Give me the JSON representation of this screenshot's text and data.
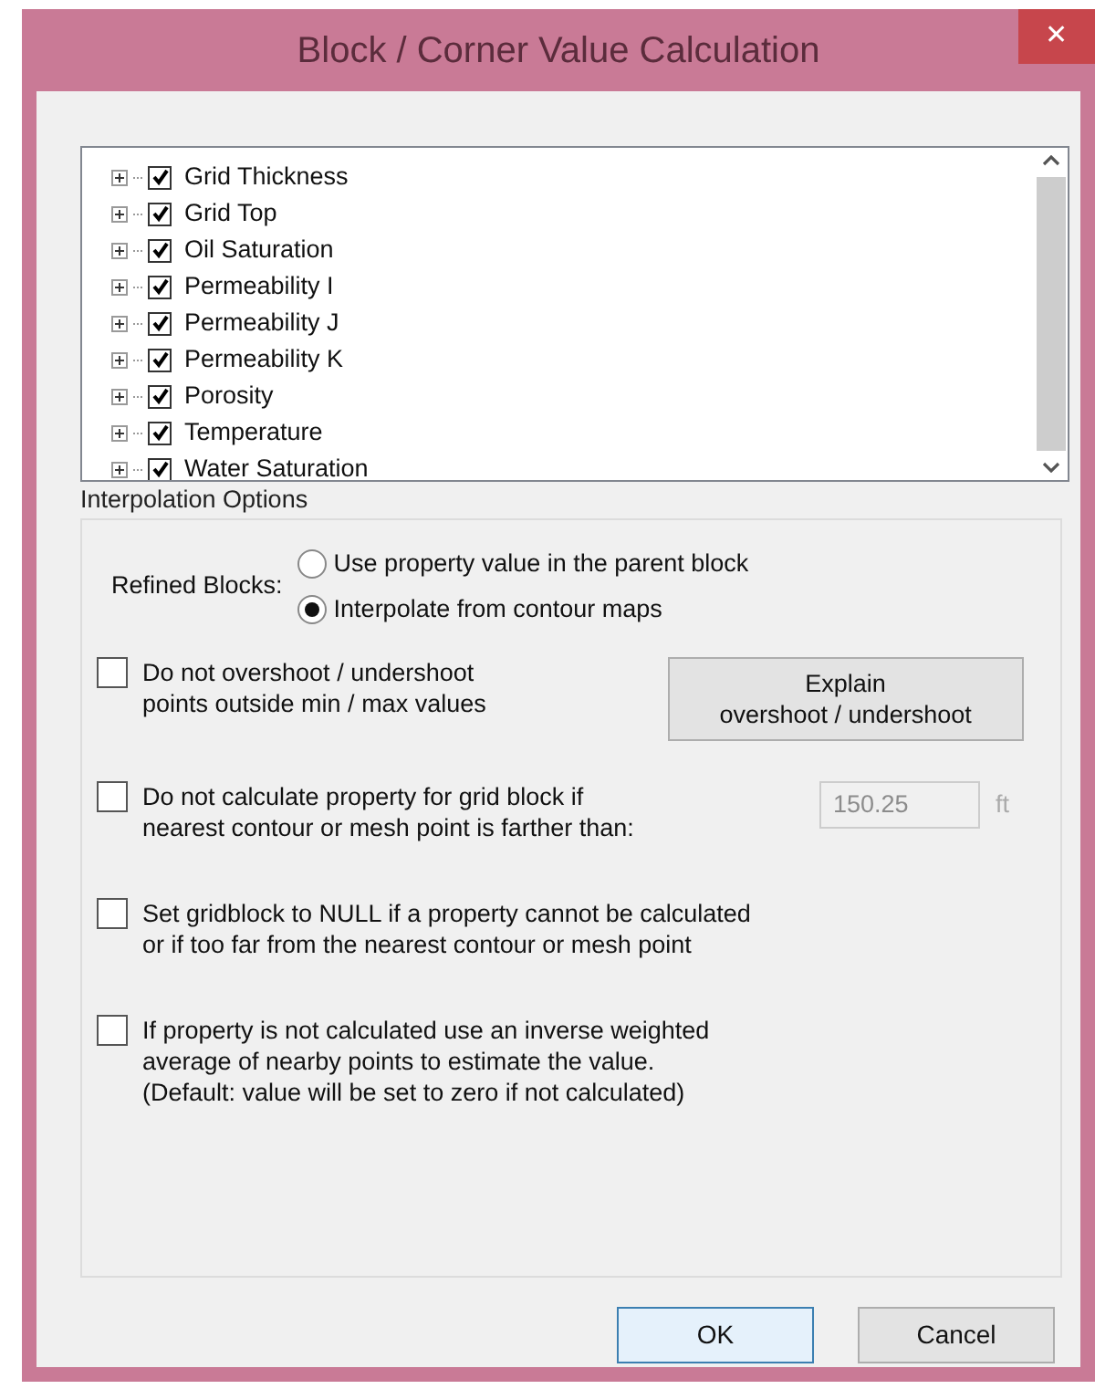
{
  "window": {
    "title": "Block / Corner Value Calculation",
    "close": "✕"
  },
  "tree": {
    "items": [
      {
        "label": "Grid Thickness",
        "checked": true,
        "expanded": false
      },
      {
        "label": "Grid Top",
        "checked": true,
        "expanded": false
      },
      {
        "label": "Oil Saturation",
        "checked": true,
        "expanded": false
      },
      {
        "label": "Permeability I",
        "checked": true,
        "expanded": false
      },
      {
        "label": "Permeability J",
        "checked": true,
        "expanded": false
      },
      {
        "label": "Permeability K",
        "checked": true,
        "expanded": false
      },
      {
        "label": "Porosity",
        "checked": true,
        "expanded": false
      },
      {
        "label": "Temperature",
        "checked": true,
        "expanded": false
      },
      {
        "label": "Water Saturation",
        "checked": true,
        "expanded": false
      }
    ]
  },
  "interpolation_options": {
    "title": "Interpolation Options",
    "refined_blocks": {
      "label": "Refined Blocks:",
      "options": [
        {
          "label": "Use property value in the parent block",
          "selected": false
        },
        {
          "label": "Interpolate from contour maps",
          "selected": true
        }
      ]
    },
    "options": [
      {
        "label": "Do not overshoot / undershoot\npoints outside min / max values",
        "checked": false,
        "button": "Explain\novershoot / undershoot"
      },
      {
        "label": "Do not calculate property for grid block if\nnearest contour or mesh point is farther than:",
        "checked": false,
        "field": {
          "value": "150.25",
          "unit": "ft",
          "disabled": true
        }
      },
      {
        "label": "Set gridblock to NULL if a property cannot be calculated\nor if too far from the nearest contour or mesh point",
        "checked": false
      },
      {
        "label": "If property is not calculated use an inverse weighted\naverage of nearby points to estimate the value.\n(Default: value will be set to zero if not calculated)",
        "checked": false
      }
    ]
  },
  "buttons": [
    {
      "label": "OK",
      "default": true
    },
    {
      "label": "Cancel",
      "default": false
    }
  ]
}
